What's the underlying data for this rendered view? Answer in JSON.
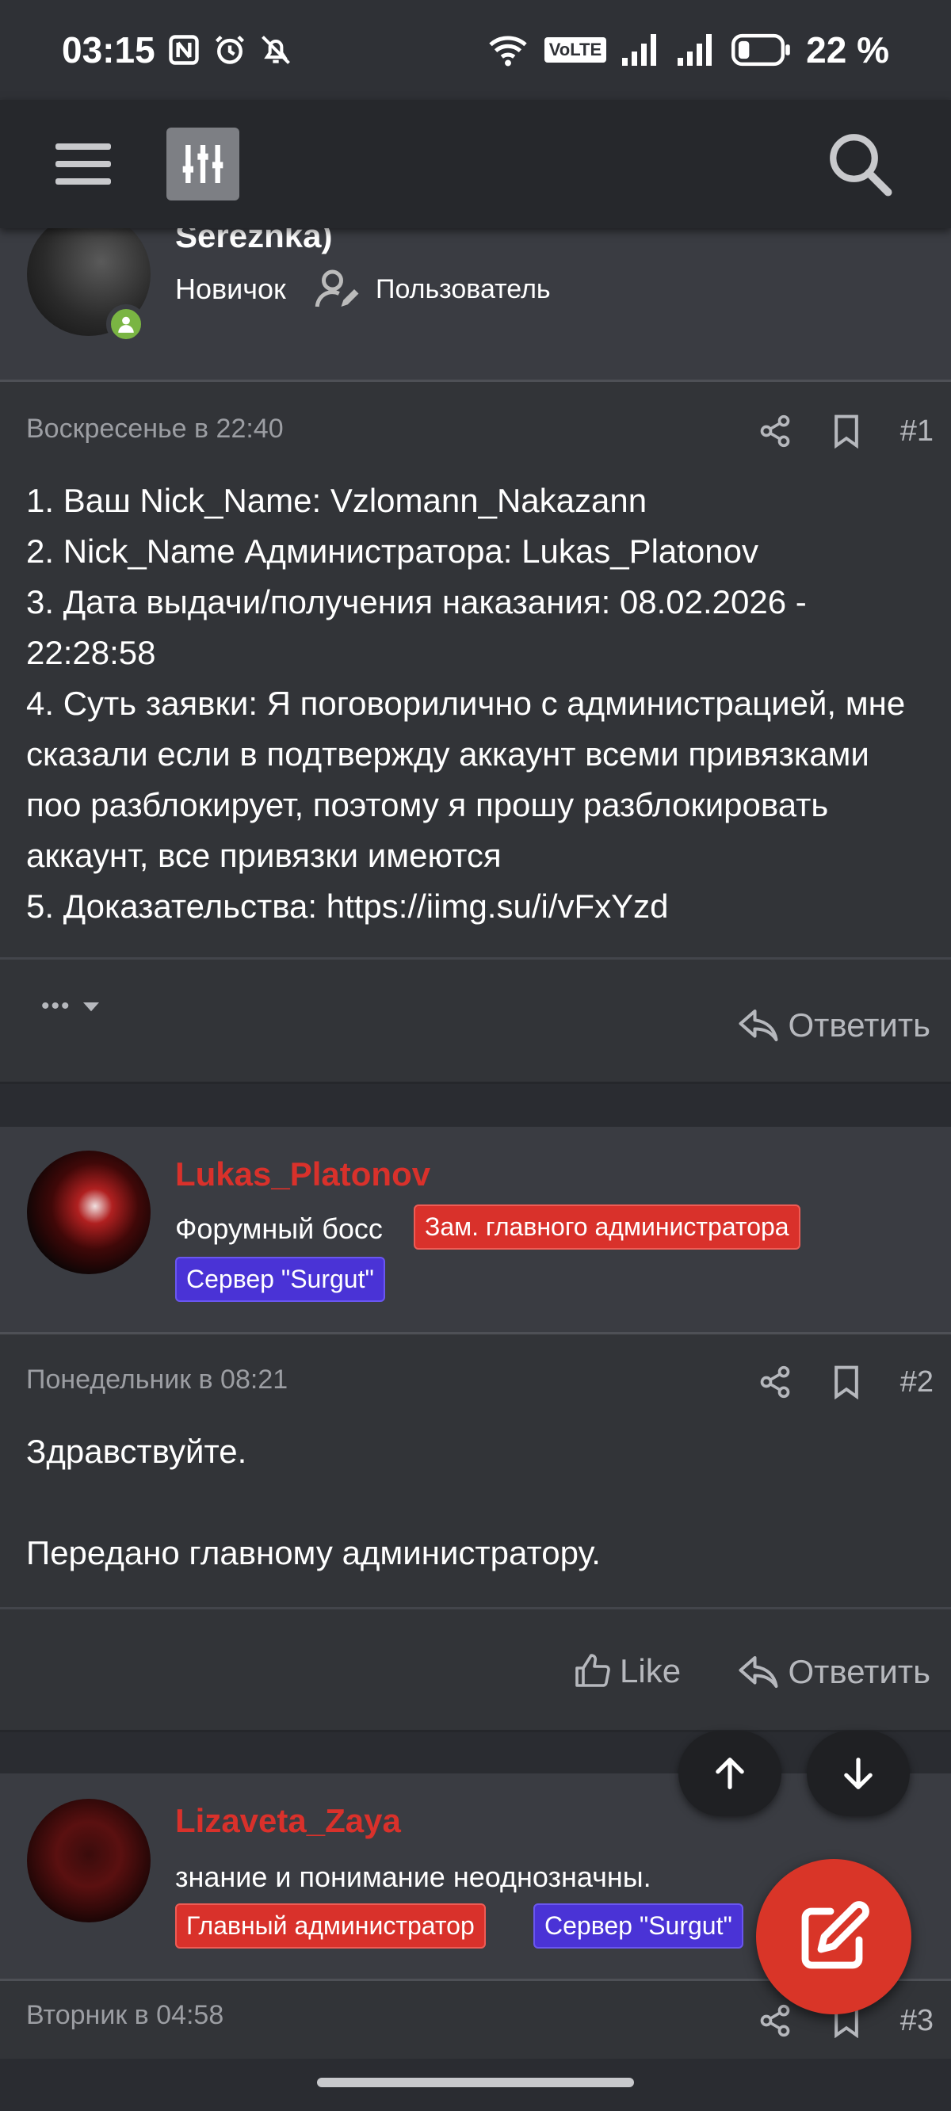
{
  "status_bar": {
    "time": "03:15",
    "battery": "22 %",
    "network_label": "VoLTE"
  },
  "app_bar": {
    "menu_icon": "hamburger-menu-icon",
    "filter_icon": "filter-sliders-icon",
    "search_icon": "search-icon"
  },
  "posts": [
    {
      "author": {
        "name": "Sereznka)",
        "title": "Новичок",
        "role_label": "Пользователь",
        "online": true
      },
      "date": "Воскресенье в 22:40",
      "number": "#1",
      "text": "1. Ваш Nick_Name: Vzlomann_Nakazann\n2. Nick_Name Администратора: Lukas_Platonov\n3. Дата выдачи/получения наказания: 08.02.2026 - 22:28:58\n4. Суть заявки: Я поговорилично с администрацией, мне сказали если в подтвержду аккаунт всеми привязками поо разблокирует, поэтому я прошу разблокировать аккаунт, все привязки имеются\n5. Доказательства: https://iimg.su/i/vFxYzd",
      "footer": {
        "more": "•••",
        "reply": "Ответить"
      }
    },
    {
      "author": {
        "name": "Lukas_Platonov",
        "title": "Форумный босс",
        "badges": [
          "Зам. главного администратора",
          "Сервер \"Surgut\""
        ]
      },
      "date": "Понедельник в 08:21",
      "number": "#2",
      "text": "Здравствуйте.\n\nПередано главному администратору.",
      "footer": {
        "like": "Like",
        "reply": "Ответить"
      }
    },
    {
      "author": {
        "name": "Lizaveta_Zaya",
        "title": "знание и понимание неоднозначны.",
        "badges": [
          "Главный администратор",
          "Сервер \"Surgut\""
        ]
      },
      "date": "Вторник в 04:58",
      "number": "#3"
    }
  ],
  "colors": {
    "accent_red": "#d9312b",
    "badge_blue": "#4a33d6",
    "online_green": "#7ab543",
    "background": "#2a2c31"
  }
}
